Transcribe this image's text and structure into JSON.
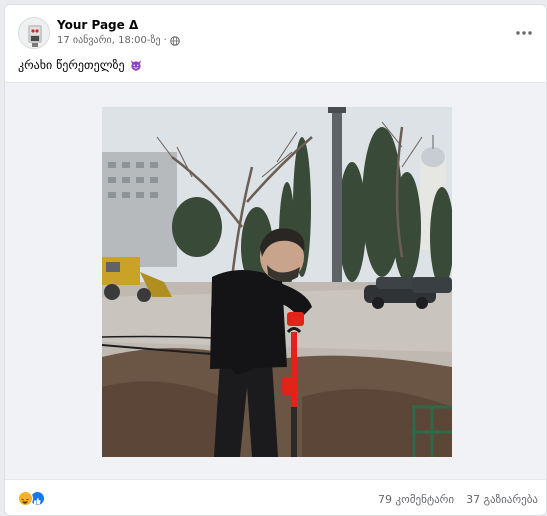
{
  "post": {
    "page_name": "Your Page Δ",
    "timestamp": "17 იანვარი, 18:00-ზე",
    "separator": "·",
    "audience_icon": "globe-icon",
    "more_icon": "ellipsis-icon",
    "caption": "კრახი წერეთელზე",
    "caption_emoji": "devil-face-emoji"
  },
  "footer": {
    "reaction_icons": [
      "haha-emoji",
      "like-icon"
    ],
    "comments": "79 კომენტარი",
    "shares": "37 გაზიარება"
  },
  "colors": {
    "card_bg": "#ffffff",
    "page_bg": "#e9ebee",
    "media_bg": "#f0f2f5",
    "secondary_text": "#65676b",
    "like_blue": "#1877f2",
    "haha_yellow": "#f7b125",
    "shovel_red": "#e2231a"
  }
}
